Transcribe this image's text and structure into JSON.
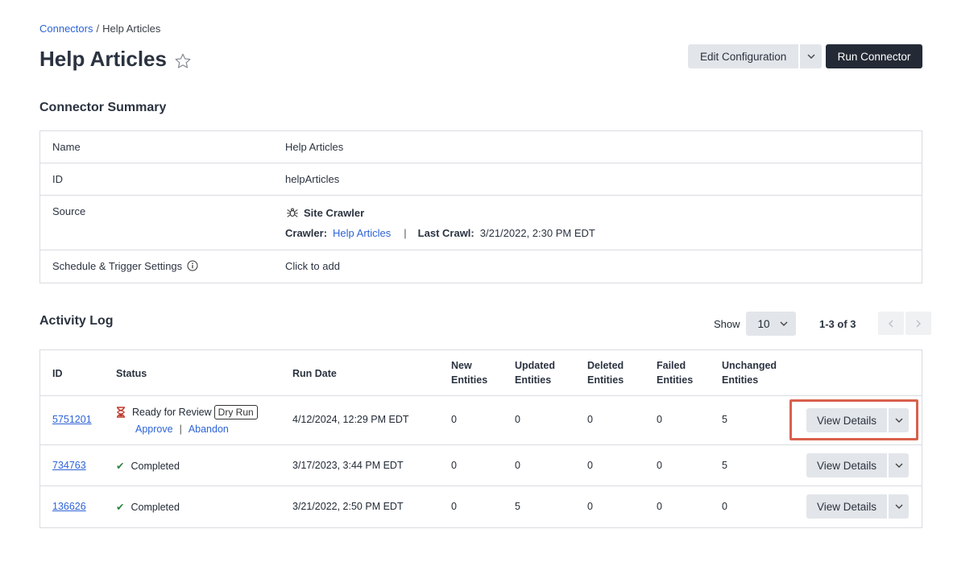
{
  "breadcrumb": {
    "parent": "Connectors",
    "separator": "/",
    "current": "Help Articles"
  },
  "header": {
    "title": "Help Articles",
    "edit_label": "Edit Configuration",
    "run_label": "Run Connector"
  },
  "summary": {
    "title": "Connector Summary",
    "name_label": "Name",
    "name_value": "Help Articles",
    "id_label": "ID",
    "id_value": "helpArticles",
    "source_label": "Source",
    "source_type": "Site Crawler",
    "crawler_label": "Crawler:",
    "crawler_link": "Help Articles",
    "last_crawl_label": "Last Crawl:",
    "last_crawl_value": "3/21/2022, 2:30 PM EDT",
    "schedule_label": "Schedule & Trigger Settings",
    "schedule_value": "Click to add"
  },
  "activity": {
    "title": "Activity Log",
    "show_label": "Show",
    "page_size": "10",
    "range": "1-3 of 3",
    "columns": {
      "id": "ID",
      "status": "Status",
      "run_date": "Run Date",
      "new_1": "New",
      "new_2": "Entities",
      "updated_1": "Updated",
      "updated_2": "Entities",
      "deleted_1": "Deleted",
      "deleted_2": "Entities",
      "failed_1": "Failed",
      "failed_2": "Entities",
      "unchanged_1": "Unchanged",
      "unchanged_2": "Entities"
    },
    "rows": [
      {
        "id": "5751201",
        "status": "Ready for Review",
        "badge": "Dry Run",
        "approve": "Approve",
        "abandon": "Abandon",
        "run_date": "4/12/2024, 12:29 PM EDT",
        "new": "0",
        "updated": "0",
        "deleted": "0",
        "failed": "0",
        "unchanged": "5",
        "action": "View Details"
      },
      {
        "id": "734763",
        "status": "Completed",
        "run_date": "3/17/2023, 3:44 PM EDT",
        "new": "0",
        "updated": "0",
        "deleted": "0",
        "failed": "0",
        "unchanged": "5",
        "action": "View Details"
      },
      {
        "id": "136626",
        "status": "Completed",
        "run_date": "3/21/2022, 2:50 PM EDT",
        "new": "0",
        "updated": "5",
        "deleted": "0",
        "failed": "0",
        "unchanged": "0",
        "action": "View Details"
      }
    ]
  },
  "colors": {
    "link": "#2d63d6",
    "primary_button": "#232a35",
    "secondary_button": "#e2e5e9",
    "success": "#2e8540",
    "pending": "#c0392b",
    "highlight": "#d9604c"
  }
}
